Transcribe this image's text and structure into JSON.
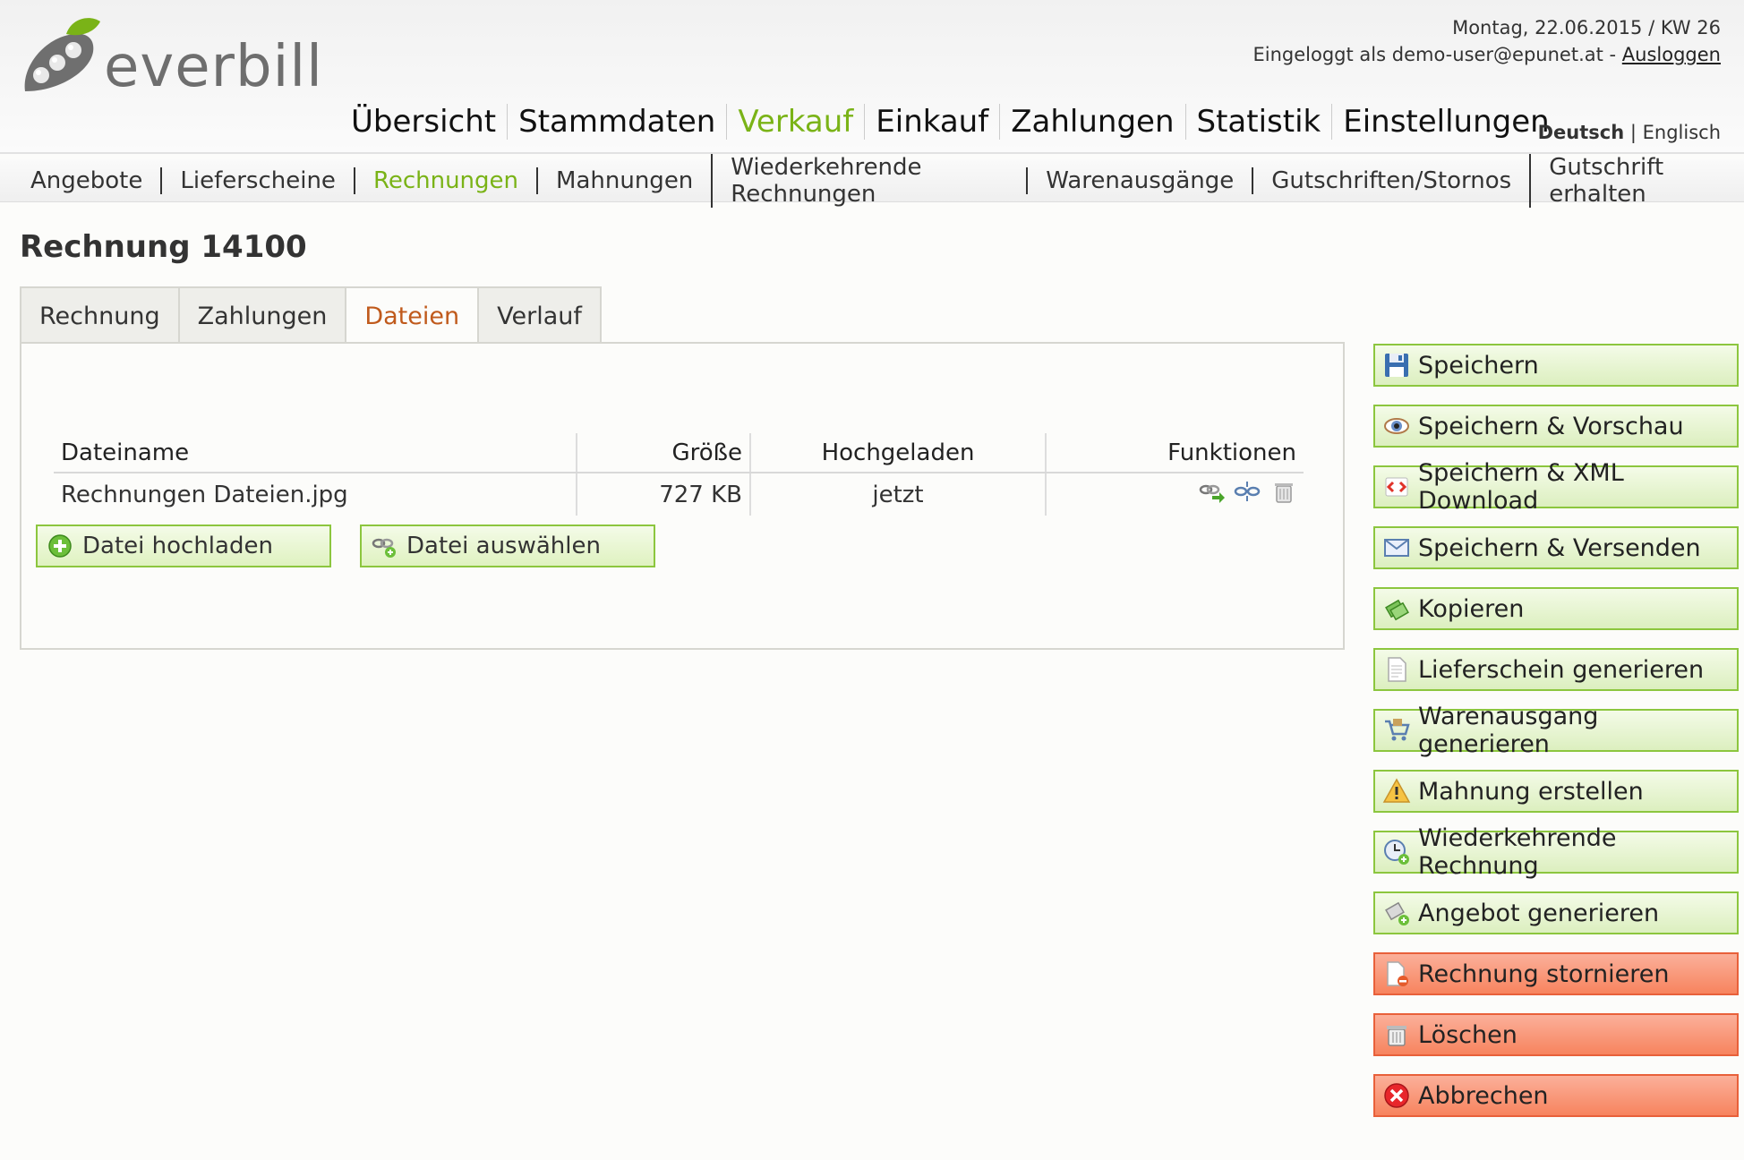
{
  "logo": {
    "text": "everbill"
  },
  "top": {
    "date": "Montag, 22.06.2015 / KW 26",
    "login_prefix": "Eingeloggt als demo-user@epunet.at - ",
    "logout": "Ausloggen"
  },
  "mainnav": [
    "Übersicht",
    "Stammdaten",
    "Verkauf",
    "Einkauf",
    "Zahlungen",
    "Statistik",
    "Einstellungen"
  ],
  "mainnav_active": "Verkauf",
  "lang": {
    "active": "Deutsch",
    "separator": "|",
    "other": "Englisch"
  },
  "subnav": [
    "Angebote",
    "Lieferscheine",
    "Rechnungen",
    "Mahnungen",
    "Wiederkehrende Rechnungen",
    "Warenausgänge",
    "Gutschriften/Stornos",
    "Gutschrift erhalten"
  ],
  "subnav_active": "Rechnungen",
  "page_title": "Rechnung 14100",
  "tabs": [
    "Rechnung",
    "Zahlungen",
    "Dateien",
    "Verlauf"
  ],
  "tabs_active": "Dateien",
  "files": {
    "headers": {
      "name": "Dateiname",
      "size": "Größe",
      "uploaded": "Hochgeladen",
      "functions": "Funktionen"
    },
    "rows": [
      {
        "name": "Rechnungen Dateien.jpg",
        "size": "727 KB",
        "uploaded": "jetzt"
      }
    ],
    "upload_button": "Datei hochladen",
    "select_button": "Datei auswählen"
  },
  "side_buttons": [
    {
      "label": "Speichern",
      "icon": "floppy-disk-icon",
      "style": "green"
    },
    {
      "label": "Speichern & Vorschau",
      "icon": "eye-icon",
      "style": "green"
    },
    {
      "label": "Speichern & XML Download",
      "icon": "xml-code-icon",
      "style": "green"
    },
    {
      "label": "Speichern & Versenden",
      "icon": "envelope-icon",
      "style": "green"
    },
    {
      "label": "Kopieren",
      "icon": "copy-icon",
      "style": "green"
    },
    {
      "label": "Lieferschein generieren",
      "icon": "document-icon",
      "style": "green"
    },
    {
      "label": "Warenausgang generieren",
      "icon": "cart-icon",
      "style": "green"
    },
    {
      "label": "Mahnung erstellen",
      "icon": "warning-icon",
      "style": "green"
    },
    {
      "label": "Wiederkehrende Rechnung",
      "icon": "clock-icon",
      "style": "green"
    },
    {
      "label": "Angebot generieren",
      "icon": "tag-add-icon",
      "style": "green"
    },
    {
      "label": "Rechnung stornieren",
      "icon": "document-cancel-icon",
      "style": "red"
    },
    {
      "label": "Löschen",
      "icon": "trash-icon",
      "style": "red"
    },
    {
      "label": "Abbrechen",
      "icon": "close-icon",
      "style": "red"
    }
  ],
  "colors": {
    "accent_green": "#7ab317",
    "active_tab": "#c05a1c",
    "green_border": "#8cc63e",
    "red_border": "#e8603a"
  }
}
